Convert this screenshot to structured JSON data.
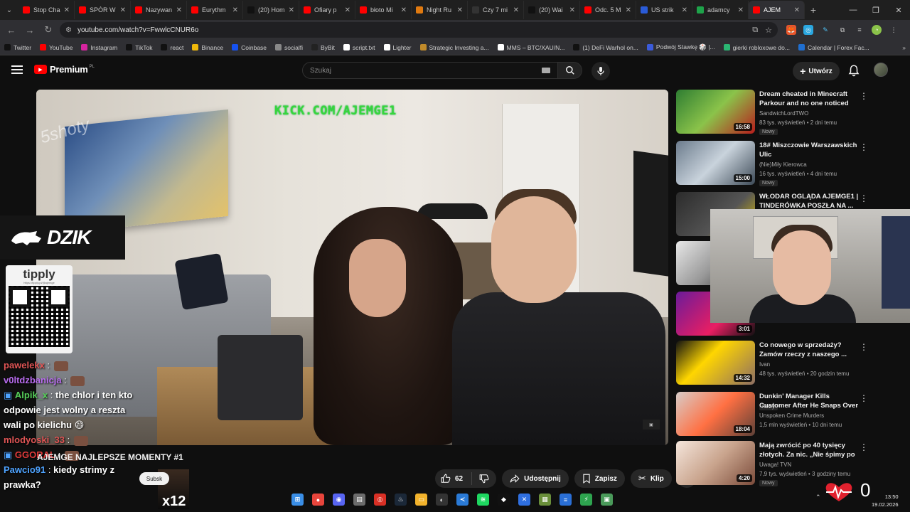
{
  "browser": {
    "tabs": [
      {
        "title": "Stop Cha",
        "color": "#ff0000"
      },
      {
        "title": "SPÓR W",
        "color": "#ff0000"
      },
      {
        "title": "Nazywan",
        "color": "#ff0000"
      },
      {
        "title": "Eurythm",
        "color": "#ff0000"
      },
      {
        "title": "(20) Hom",
        "color": "#111111"
      },
      {
        "title": "Ofiary p",
        "color": "#ff0000"
      },
      {
        "title": "błoto Mi",
        "color": "#ff0000"
      },
      {
        "title": "Night Ru",
        "color": "#e07a10"
      },
      {
        "title": "Czy 7 mi",
        "color": "#333333"
      },
      {
        "title": "(20) Wai",
        "color": "#111111"
      },
      {
        "title": "Odc. 5 M",
        "color": "#ff0000"
      },
      {
        "title": "US strik",
        "color": "#2a5bd7"
      },
      {
        "title": "adamcy",
        "color": "#1ea34a"
      },
      {
        "title": "AJEM",
        "color": "#ff0000",
        "active": true
      }
    ],
    "url": "youtube.com/watch?v=FwwlcCNUR6o",
    "bookmarks": [
      {
        "label": "Twitter",
        "color": "#111111"
      },
      {
        "label": "YouTube",
        "color": "#ff0000"
      },
      {
        "label": "Instagram",
        "color": "#d6249f"
      },
      {
        "label": "TikTok",
        "color": "#111111"
      },
      {
        "label": "react",
        "color": "#111111"
      },
      {
        "label": "Binance",
        "color": "#f0b90b"
      },
      {
        "label": "Coinbase",
        "color": "#1652f0"
      },
      {
        "label": "socialfi",
        "color": "#888888"
      },
      {
        "label": "ByBit",
        "color": "#222222"
      },
      {
        "label": "script.txt",
        "color": "#ffffff"
      },
      {
        "label": "Lighter",
        "color": "#ffffff"
      },
      {
        "label": "Strategic Investing a...",
        "color": "#c08a2a"
      },
      {
        "label": "MMS – BTC/XAU/N...",
        "color": "#ffffff"
      },
      {
        "label": "(1) DeFi Warhol on...",
        "color": "#111111"
      },
      {
        "label": "Podwój Stawkę 🎲 |...",
        "color": "#3b5bdb"
      },
      {
        "label": "gierki robloxowe do...",
        "color": "#2bb673"
      },
      {
        "label": "Calendar | Forex Fac...",
        "color": "#1f6fd1"
      }
    ]
  },
  "youtube": {
    "logo": "Premium",
    "logo_region": "PL",
    "search_placeholder": "Szukaj",
    "create_label": "Utwórz",
    "video": {
      "overlay_kick": "KICK.COM/AJEMGE1",
      "watermark": "5shoty",
      "title": "AJEMGE NAJLEPSZE MOMENTY #1",
      "likes": "62",
      "share_label": "Udostępnij",
      "save_label": "Zapisz",
      "clip_label": "Klip",
      "subscribe_label": "Subsk",
      "sponsor": "DZIK",
      "tip_brand": "tipply",
      "tip_url": "https://tipply.pl/@ajemge",
      "multiplier": "x12"
    },
    "chat": [
      {
        "user": "pawelekx",
        "text": "",
        "color": "#e05555",
        "emote": true
      },
      {
        "user": "v0ltdzbanicja",
        "text": "",
        "color": "#b96cf0",
        "emote": true
      },
      {
        "user": "Alpik_x",
        "text": "the chlor i ten kto",
        "color": "#57d05a",
        "badge": true
      },
      {
        "user": "",
        "text": "odpowie jest wolny a reszta",
        "color": "#ffffff"
      },
      {
        "user": "",
        "text": "wali po kielichu 😄",
        "color": "#ffffff"
      },
      {
        "user": "mlodyoski_33",
        "text": "",
        "color": "#e05555",
        "emote": true
      },
      {
        "user": "GGORAL",
        "text": "",
        "color": "#e03a3a",
        "badge": true,
        "emote": true
      },
      {
        "user": "Pawcio91",
        "text": "kiedy strimy z",
        "color": "#4ea3ff"
      },
      {
        "user": "",
        "text": "prawka?",
        "color": "#ffffff"
      }
    ],
    "recommendations": [
      {
        "title": "Dream cheated in Minecraft Parkour and no one noticed",
        "channel": "SandwichLordTWO",
        "meta": "83 tys. wyświetleń • 2 dni temu",
        "badge": "Nowy",
        "duration": "16:58",
        "thumb": "linear-gradient(135deg,#2e7d32,#8bc34a 50%,#b71c1c)"
      },
      {
        "title": "18# Miszczowie Warszawskich Ulic",
        "channel": "(Nie)Miły Kierowca",
        "meta": "16 tys. wyświetleń • 4 dni temu",
        "badge": "Nowy",
        "duration": "15:00",
        "thumb": "linear-gradient(135deg,#6b7b8c,#c9d3dc 50%,#3d4a57)"
      },
      {
        "title": "WŁODAR OGLĄDA AJEMGE1 | TINDERÓWKA POSZŁA NA ...",
        "channel": "",
        "meta": "",
        "badge": "",
        "duration": "",
        "thumb": "linear-gradient(135deg,#2b2b2b,#555 60%,#e4c300)"
      },
      {
        "title": "",
        "channel": "",
        "meta": "",
        "badge": "",
        "duration": "",
        "thumb": "linear-gradient(135deg,#e8e8e8,#999 50%,#222)"
      },
      {
        "title": "",
        "channel": "",
        "meta": "",
        "badge": "Nowy",
        "duration": "3:01",
        "thumb": "linear-gradient(135deg,#6a1b9a,#e91e63 60%,#111)"
      },
      {
        "title": "Co nowego w sprzedaży? Zamów rzeczy z naszego ...",
        "channel": "Ivan",
        "meta": "48 tys. wyświetleń • 20 godzin temu",
        "badge": "",
        "duration": "14:32",
        "thumb": "linear-gradient(135deg,#111,#ffd600 40%,#8d6e63)"
      },
      {
        "title": "Dunkin' Manager Kills Customer After He Snaps Over Cold ...",
        "channel": "Unspoken Crime Murders",
        "meta": "1,5 mln wyświetleń • 10 dni temu",
        "badge": "",
        "duration": "18:04",
        "thumb": "linear-gradient(135deg,#d7ccc8,#ff7043 50%,#5d4037)"
      },
      {
        "title": "Mają zwrócić po 40 tysięcy złotych. Za nic. „Nie śpimy po ...",
        "channel": "Uwaga! TVN",
        "meta": "7,9 tys. wyświetleń • 3 godziny temu",
        "badge": "Nowy",
        "duration": "4:20",
        "thumb": "linear-gradient(135deg,#f5e6dc,#c9a48d 50%,#7b4b3a)"
      }
    ]
  },
  "taskbar": {
    "icons": [
      {
        "name": "windows-start",
        "color": "#3a8ee6",
        "glyph": "⊞"
      },
      {
        "name": "chrome",
        "color": "#e8453c",
        "glyph": "●"
      },
      {
        "name": "discord",
        "color": "#5865f2",
        "glyph": "◉"
      },
      {
        "name": "notepad",
        "color": "#6c6c6c",
        "glyph": "▤"
      },
      {
        "name": "chrome-alt",
        "color": "#d93025",
        "glyph": "◎"
      },
      {
        "name": "steam",
        "color": "#1b2838",
        "glyph": "♨"
      },
      {
        "name": "explorer",
        "color": "#f2b32c",
        "glyph": "▭"
      },
      {
        "name": "obs",
        "color": "#333333",
        "glyph": "◐"
      },
      {
        "name": "vscode",
        "color": "#2a7ad6",
        "glyph": "≺"
      },
      {
        "name": "spotify",
        "color": "#1ed760",
        "glyph": "≋"
      },
      {
        "name": "kick",
        "color": "#111111",
        "glyph": "◆"
      },
      {
        "name": "x-app",
        "color": "#2f6fe0",
        "glyph": "✕"
      },
      {
        "name": "game",
        "color": "#6a8f3a",
        "glyph": "▦"
      },
      {
        "name": "docs",
        "color": "#2a6fd6",
        "glyph": "≡"
      },
      {
        "name": "bolt",
        "color": "#2ea44f",
        "glyph": "⚡"
      },
      {
        "name": "cube",
        "color": "#4a9a5a",
        "glyph": "▣"
      }
    ],
    "time": "13:50",
    "date": "19.02.2026",
    "viewer_count": "0"
  }
}
